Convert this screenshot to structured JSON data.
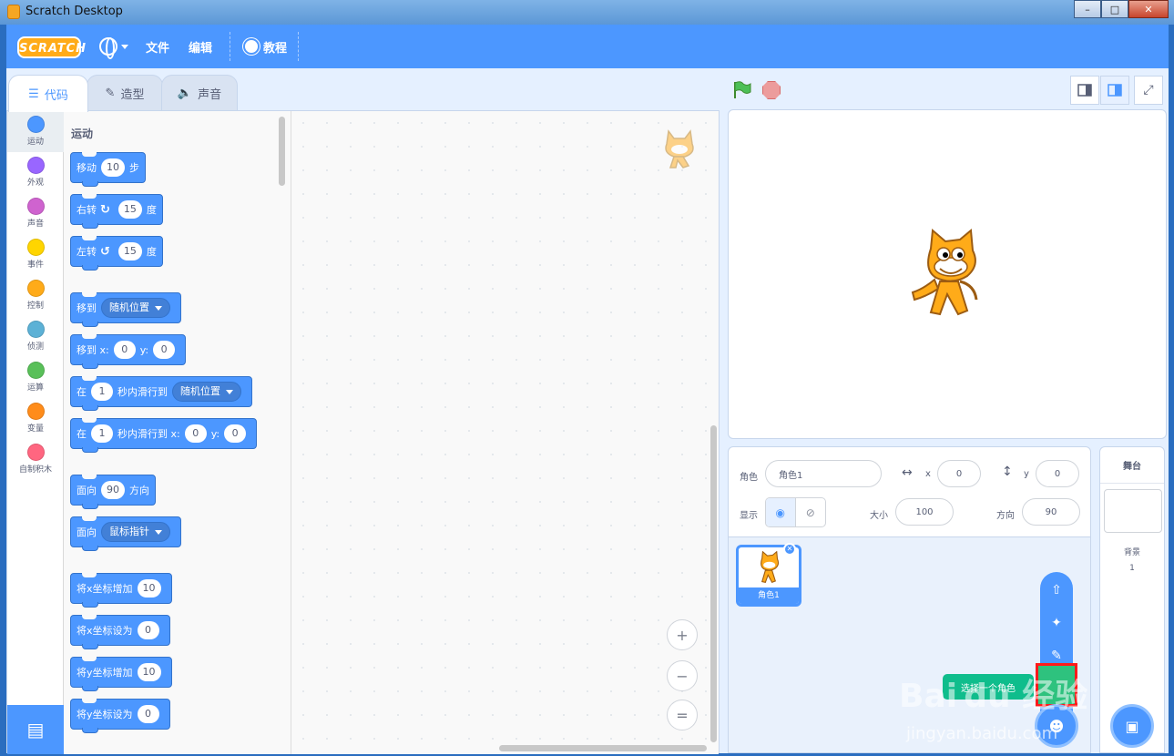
{
  "window": {
    "title": "Scratch Desktop",
    "min": "–",
    "max": "□",
    "close": "✕"
  },
  "menubar": {
    "logo": "SCRATCH",
    "file": "文件",
    "edit": "编辑",
    "tutorials": "教程"
  },
  "tabs": [
    {
      "label": "代码",
      "icon": "code-icon"
    },
    {
      "label": "造型",
      "icon": "brush-icon"
    },
    {
      "label": "声音",
      "icon": "speaker-icon"
    }
  ],
  "categories": [
    {
      "label": "运动",
      "color": "#4c97ff"
    },
    {
      "label": "外观",
      "color": "#9966ff"
    },
    {
      "label": "声音",
      "color": "#cf63cf"
    },
    {
      "label": "事件",
      "color": "#ffd500"
    },
    {
      "label": "控制",
      "color": "#ffab19"
    },
    {
      "label": "侦测",
      "color": "#5cb1d6"
    },
    {
      "label": "运算",
      "color": "#59c059"
    },
    {
      "label": "变量",
      "color": "#ff8c1a"
    },
    {
      "label": "自制积木",
      "color": "#ff6680"
    }
  ],
  "palette": {
    "title": "运动",
    "move": {
      "a": "移动",
      "n": "10",
      "b": "步"
    },
    "turn_right": {
      "a": "右转",
      "n": "15",
      "b": "度"
    },
    "turn_left": {
      "a": "左转",
      "n": "15",
      "b": "度"
    },
    "goto": {
      "a": "移到",
      "d": "随机位置"
    },
    "goto_xy": {
      "a": "移到 x:",
      "x": "0",
      "y_label": "y:",
      "y": "0"
    },
    "glide": {
      "a": "在",
      "n": "1",
      "b": "秒内滑行到",
      "d": "随机位置"
    },
    "glide_xy": {
      "a": "在",
      "n": "1",
      "b": "秒内滑行到 x:",
      "x": "0",
      "y_label": "y:",
      "y": "0"
    },
    "point_dir": {
      "a": "面向",
      "n": "90",
      "b": "方向"
    },
    "point_towards": {
      "a": "面向",
      "d": "鼠标指针"
    },
    "change_x": {
      "a": "将x坐标增加",
      "n": "10"
    },
    "set_x": {
      "a": "将x坐标设为",
      "n": "0"
    },
    "change_y": {
      "a": "将y坐标增加",
      "n": "10"
    },
    "set_y": {
      "a": "将y坐标设为",
      "n": "0"
    }
  },
  "zoom": {
    "in": "+",
    "out": "−",
    "reset": "="
  },
  "sprite_info": {
    "sprite_label": "角色",
    "sprite_name": "角色1",
    "x_label": "x",
    "x": "0",
    "y_label": "y",
    "y": "0",
    "show_label": "显示",
    "size_label": "大小",
    "size": "100",
    "direction_label": "方向",
    "direction": "90"
  },
  "sprites": [
    {
      "name": "角色1"
    }
  ],
  "tooltip": "选择一个角色",
  "stage_pane": {
    "title": "舞台",
    "backdrops_label": "背景",
    "backdrops_count": "1"
  },
  "watermark": {
    "brand": "Bai du 经验",
    "url": "jingyan.baidu.com"
  }
}
